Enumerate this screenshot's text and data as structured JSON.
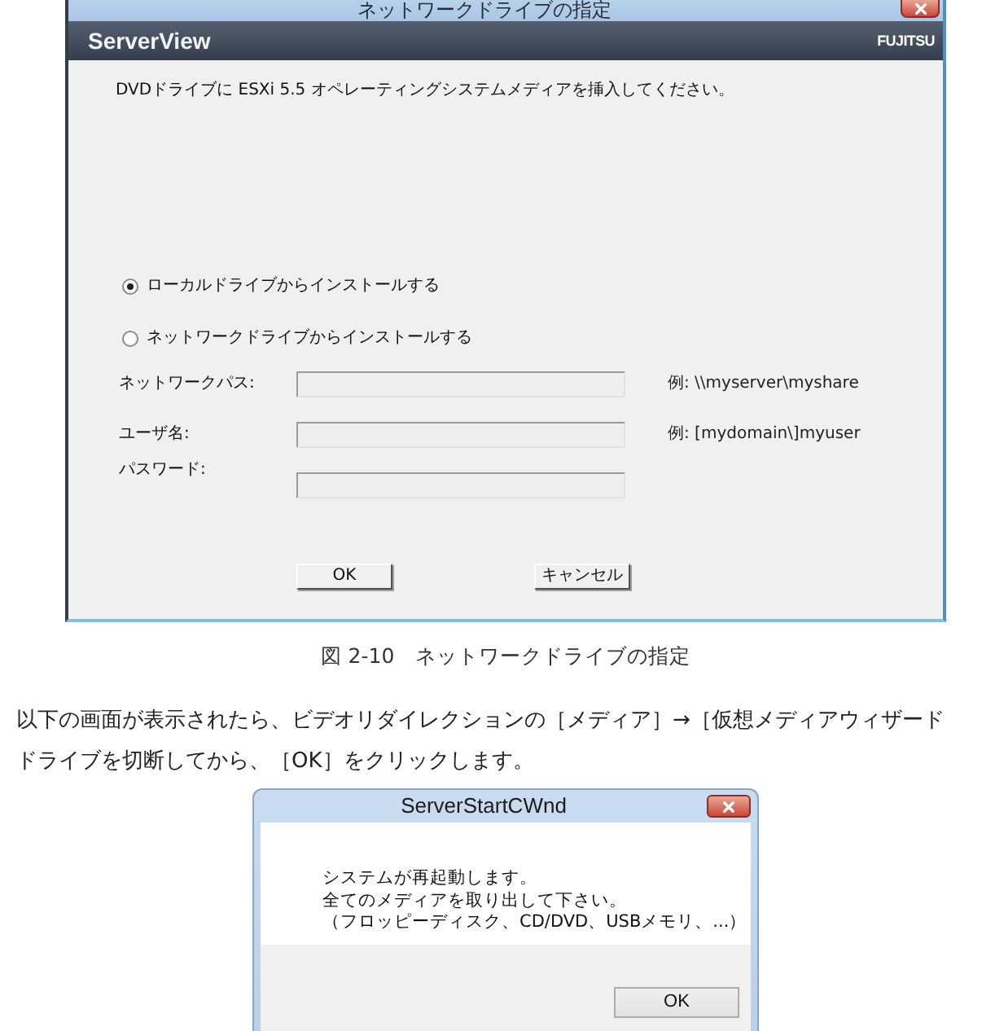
{
  "main_window": {
    "title": "ネットワークドライブの指定",
    "header": {
      "product": "ServerView",
      "logo": "FUJITSU"
    },
    "instruction": "DVDドライブに ESXi 5.5 オペレーティングシステムメディアを挿入してください。",
    "install_options": [
      {
        "label": "ローカルドライブからインストールする",
        "selected": true
      },
      {
        "label": "ネットワークドライブからインストールする",
        "selected": false
      }
    ],
    "fields": [
      {
        "label": "ネットワークパス:",
        "disabled": true,
        "example": "例: \\\\myserver\\myshare"
      },
      {
        "label": "ユーザ名:",
        "disabled": true,
        "example": "例: [mydomain\\]myuser"
      },
      {
        "label": "パスワード:",
        "disabled": true
      }
    ],
    "buttons": [
      "OK",
      "キャンセル"
    ]
  },
  "caption": "図 2-10　ネットワークドライブの指定",
  "paragraph_lines": [
    "以下の画面が表示されたら、ビデオリダイレクションの［メディア］→［仮想メディアウィザード",
    "ドライブを切断してから、［OK］をクリックします。"
  ],
  "restart_dialog": {
    "title": "ServerStartCWnd",
    "message_lines": [
      "システムが再起動します。",
      "全てのメディアを取り出して下さい。",
      "（フロッピーディスク、CD/DVD、USBメモリ、...）"
    ],
    "buttons": [
      "OK"
    ]
  }
}
